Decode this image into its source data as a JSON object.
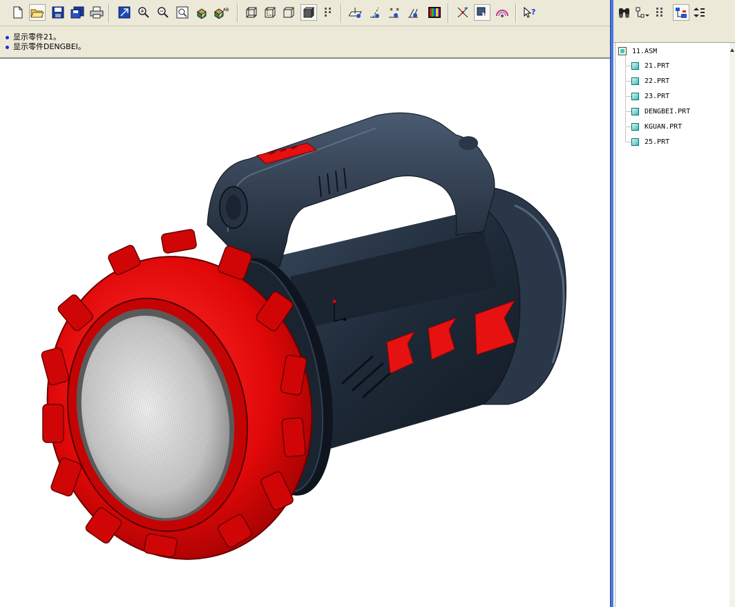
{
  "messages": [
    "显示零件21。",
    "显示零件DENGBEI。"
  ],
  "toolbar": {
    "groups": [
      [
        "new-file-icon",
        "open-folder-icon",
        "save-icon",
        "save-copy-icon",
        "print-icon"
      ],
      [
        "repaint-icon",
        "zoom-in-icon",
        "zoom-out-icon",
        "refit-icon",
        "orient-icon",
        "saved-views-icon"
      ],
      [
        "wireframe-icon",
        "hidden-line-icon",
        "no-hidden-icon",
        "shaded-icon",
        "layers-icon"
      ],
      [
        "datum-planes-icon",
        "datum-axes-icon",
        "datum-points-icon",
        "coord-systems-icon",
        "color-icon"
      ],
      [
        "spin-center-icon",
        "selection-filter-icon",
        "appearance-icon"
      ],
      [
        "context-help-icon"
      ]
    ]
  },
  "tree": {
    "toolbar_icons": [
      "find-icon",
      "tree-settings-icon",
      "tree-filter-icon",
      "show-icon",
      "expand-icon"
    ],
    "root": "11.ASM",
    "items": [
      "21.PRT",
      "22.PRT",
      "23.PRT",
      "DENGBEI.PRT",
      "KGUAN.PRT",
      "25.PRT"
    ]
  },
  "colors": {
    "body": "#1e2a38",
    "bezel": "#e60a0a",
    "lens": "#c6c6c6",
    "chrome": "#ece9d8",
    "divider": "#4d7ad8"
  }
}
